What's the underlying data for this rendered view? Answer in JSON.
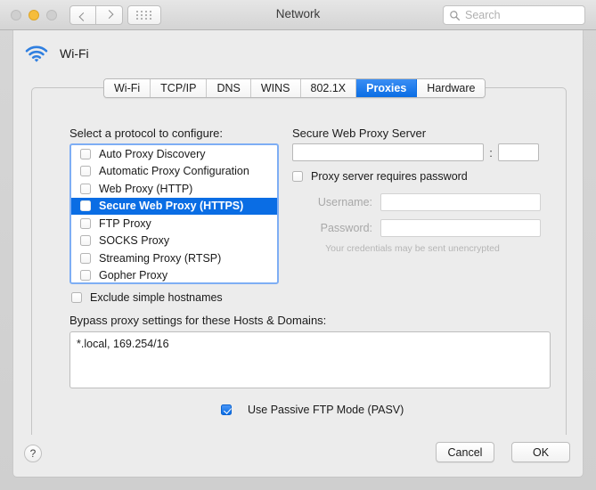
{
  "window": {
    "title": "Network",
    "traffic_lights": [
      "close",
      "minimize",
      "zoom"
    ],
    "nav_back_icon": "chevron-left-icon",
    "nav_forward_icon": "chevron-right-icon",
    "grid_icon": "show-all-preferences-icon"
  },
  "search": {
    "placeholder": "Search",
    "value": "",
    "icon": "search-icon"
  },
  "service": {
    "icon": "wifi-icon",
    "name": "Wi-Fi"
  },
  "tabs": [
    {
      "label": "Wi-Fi",
      "active": false
    },
    {
      "label": "TCP/IP",
      "active": false
    },
    {
      "label": "DNS",
      "active": false
    },
    {
      "label": "WINS",
      "active": false
    },
    {
      "label": "802.1X",
      "active": false
    },
    {
      "label": "Proxies",
      "active": true
    },
    {
      "label": "Hardware",
      "active": false
    }
  ],
  "proxies": {
    "protocol_label": "Select a protocol to configure:",
    "protocols": [
      {
        "label": "Auto Proxy Discovery",
        "checked": false,
        "selected": false
      },
      {
        "label": "Automatic Proxy Configuration",
        "checked": false,
        "selected": false
      },
      {
        "label": "Web Proxy (HTTP)",
        "checked": false,
        "selected": false
      },
      {
        "label": "Secure Web Proxy (HTTPS)",
        "checked": false,
        "selected": true
      },
      {
        "label": "FTP Proxy",
        "checked": false,
        "selected": false
      },
      {
        "label": "SOCKS Proxy",
        "checked": false,
        "selected": false
      },
      {
        "label": "Streaming Proxy (RTSP)",
        "checked": false,
        "selected": false
      },
      {
        "label": "Gopher Proxy",
        "checked": false,
        "selected": false
      }
    ],
    "exclude_simple_hostnames": {
      "label": "Exclude simple hostnames",
      "checked": false
    },
    "bypass_label": "Bypass proxy settings for these Hosts & Domains:",
    "bypass_value": "*.local, 169.254/16",
    "passive_ftp": {
      "label": "Use Passive FTP Mode (PASV)",
      "checked": true
    },
    "server_panel": {
      "title": "Secure Web Proxy Server",
      "host_value": "",
      "port_separator": ":",
      "port_value": "",
      "requires_password": {
        "label": "Proxy server requires password",
        "checked": false
      },
      "username_label": "Username:",
      "username_value": "",
      "password_label": "Password:",
      "password_value": "",
      "credentials_note": "Your credentials may be sent unencrypted"
    }
  },
  "footer": {
    "help_label": "?",
    "cancel_label": "Cancel",
    "ok_label": "OK"
  },
  "colors": {
    "accent_blue": "#0a6de4",
    "tab_active_blue": "#0a6de4",
    "focus_ring": "#7eaef4",
    "amber_light": "#f6bd3b",
    "disabled_text": "#a8a8a8"
  }
}
